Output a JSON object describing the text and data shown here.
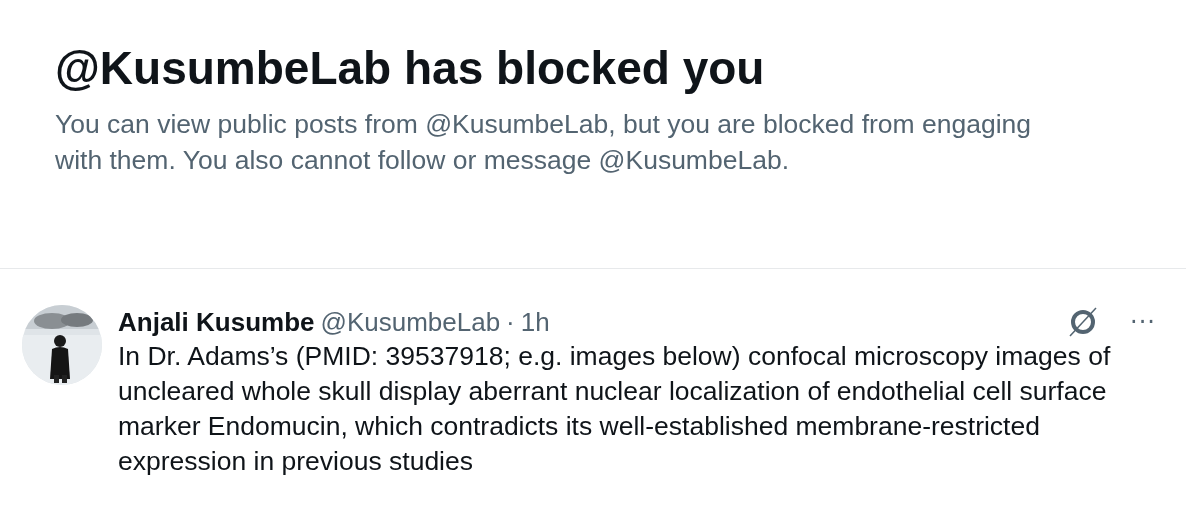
{
  "block_notice": {
    "title": "@KusumbeLab has blocked you",
    "message": "You can view public posts from @KusumbeLab, but you are blocked from engaging with them. You also cannot follow or message @KusumbeLab."
  },
  "post": {
    "author_name": "Anjali Kusumbe",
    "handle": "@KusumbeLab",
    "separator": "·",
    "time": "1h",
    "more": "···",
    "text": "In Dr. Adams’s (PMID: 39537918; e.g. images below) confocal microscopy images of uncleared whole skull display aberrant nuclear localization of endothelial cell surface marker Endomucin, which contradicts its well-established membrane-restricted expression in previous studies"
  }
}
